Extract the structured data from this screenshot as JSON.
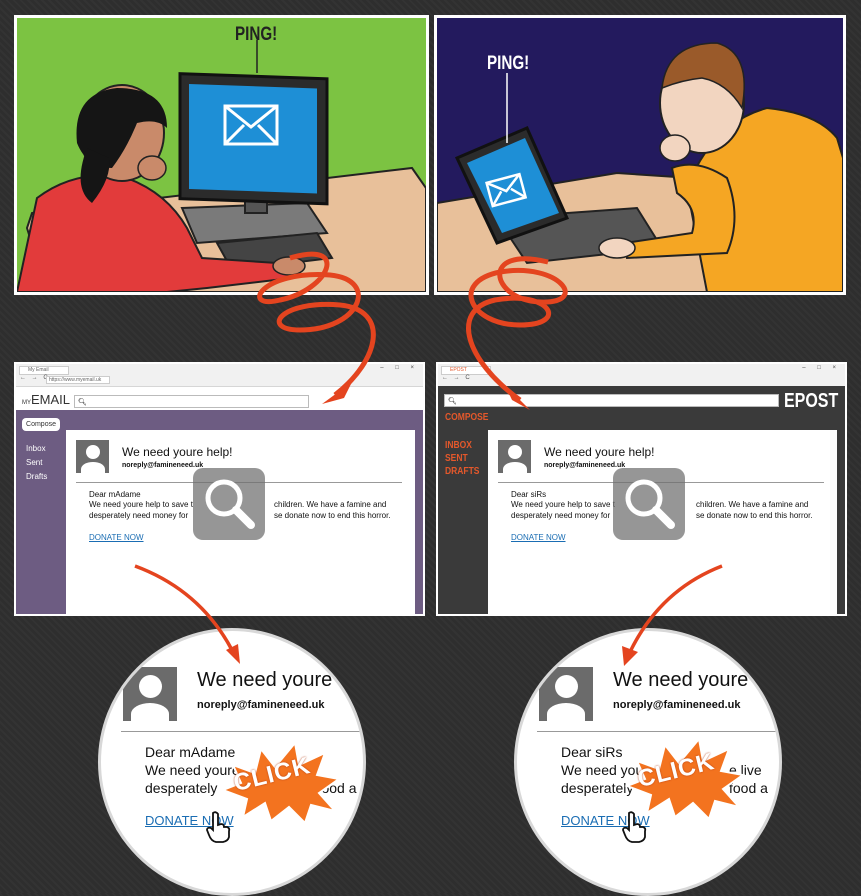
{
  "panels": {
    "woman": {
      "ping_label": "PING!"
    },
    "man": {
      "ping_label": "PING!"
    }
  },
  "left_browser": {
    "tab_label": "My Email",
    "address": "https://www.myemail.uk",
    "logo_prefix": "MY",
    "logo_text": "EMAIL",
    "compose_label": "Compose",
    "sidebar": [
      "Inbox",
      "Sent",
      "Drafts"
    ],
    "email": {
      "subject": "We need youre help!",
      "sender": "noreply@famineneed.uk",
      "greeting": "Dear mAdame",
      "line1_a": "We need youre help to save t",
      "line1_b": "children. We have a famine and",
      "line2_a": "desperately need money for ",
      "line2_b": "se donate now to end this horror.",
      "link": "DONATE NOW"
    }
  },
  "right_browser": {
    "tab_label": "EPOST",
    "brand": "EPOST",
    "compose_label": "COMPOSE",
    "sidebar": [
      "INBOX",
      "SENT",
      "DRAFTS"
    ],
    "email": {
      "subject": "We need youre help!",
      "sender": "noreply@famineneed.uk",
      "greeting": "Dear siRs",
      "line1_a": "We need youre help to save t",
      "line1_b": "children. We have a famine and",
      "line2_a": "desperately need money for ",
      "line2_b": "se donate now to end this horror.",
      "link": "DONATE NOW"
    }
  },
  "left_zoom": {
    "subject": "We need youre h",
    "sender": "noreply@famineneed.uk",
    "greeting": "Dear mAdame",
    "line1": "We need youre",
    "line2_a": "desperately",
    "line2_b": "r food a",
    "link": "DONATE NOW",
    "click_label": "CLICK"
  },
  "right_zoom": {
    "subject": "We need youre",
    "sender": "noreply@famineneed.uk",
    "greeting": "Dear siRs",
    "line1_a": "We need youre",
    "line1_b": "e live",
    "line2_a": "desperately",
    "line2_b": "food a",
    "link": "DONATE NOW",
    "click_label": "CLICK"
  },
  "colors": {
    "green_bg": "#7cc342",
    "navy_bg": "#231a5e",
    "purple_sidebar": "#6d5c82",
    "dark_ui": "#3a3a3a",
    "arrow_red": "#e4441f",
    "screen_blue": "#1e8fd6",
    "burst_orange": "#f3731f"
  }
}
